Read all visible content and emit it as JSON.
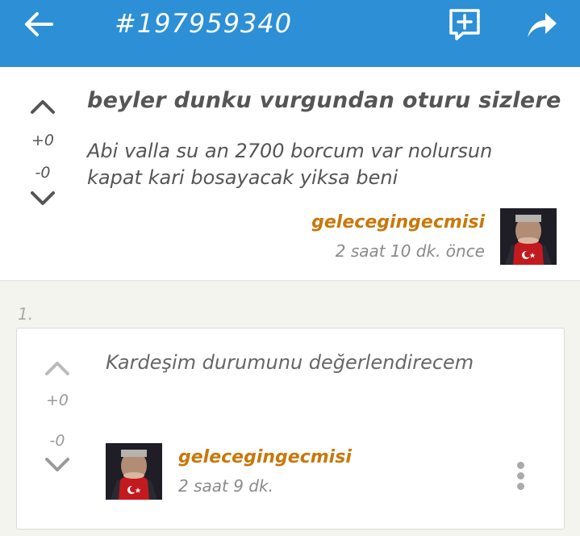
{
  "appbar": {
    "title": "#197959340",
    "back_icon": "arrow-left-icon",
    "add_icon": "add-comment-icon",
    "share_icon": "share-icon",
    "color": "#2d8fd5"
  },
  "entry": {
    "title": "beyler dunku vurgundan oturu sizlere",
    "body": "Abi valla su an 2700 borcum var nolursun kapat kari bosayacak yiksa beni",
    "upvotes": "+0",
    "downvotes": "-0",
    "author": "gelecegingecmisi",
    "time": "2 saat 10 dk. önce"
  },
  "comment": {
    "index": "1.",
    "text": "Kardeşim durumunu değerlendirecem",
    "upvotes": "+0",
    "downvotes": "-0",
    "author": "gelecegingecmisi",
    "time": "2 saat 9 dk."
  },
  "colors": {
    "author": "#c8780c",
    "accent": "#2d8fd5"
  }
}
